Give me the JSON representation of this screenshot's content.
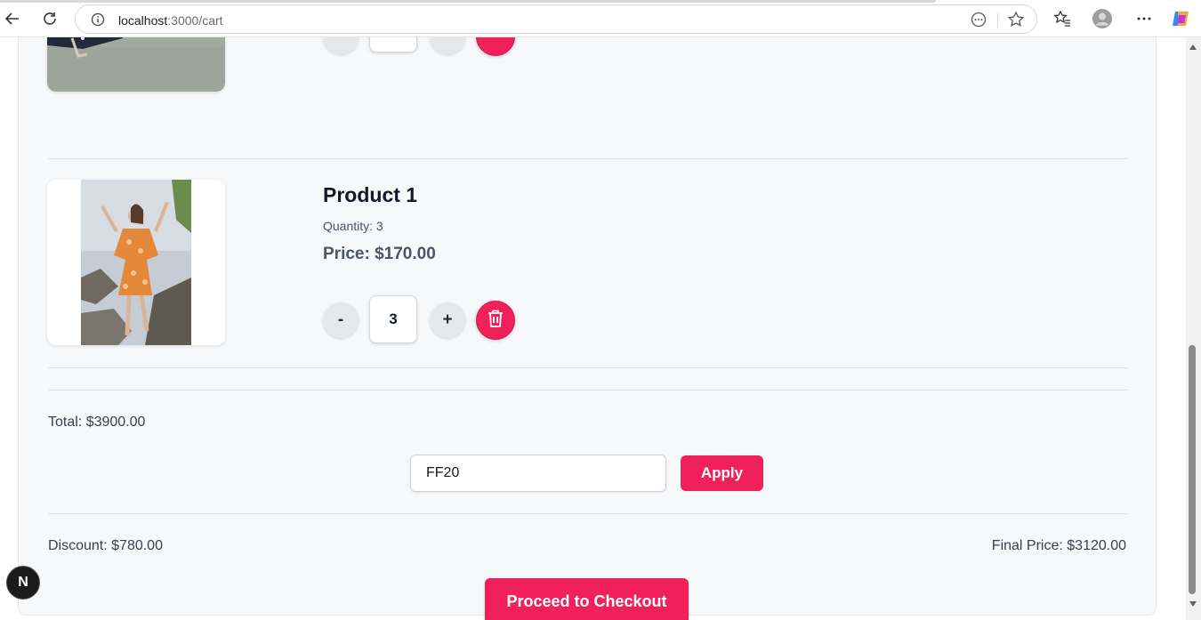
{
  "browser": {
    "url_host": "localhost",
    "url_path": ":3000/cart",
    "icons": [
      "back-icon",
      "reload-icon",
      "site-info-icon",
      "reader-mode-icon",
      "favorite-star-icon",
      "favorites-icon",
      "profile-icon",
      "more-menu-icon",
      "copilot-icon"
    ]
  },
  "cart": {
    "items": [
      {
        "name": "Product 1",
        "quantity_label": "Quantity: 3",
        "price_label": "Price: $170.00",
        "quantity_value": "3",
        "decrement_label": "-",
        "increment_label": "+"
      }
    ],
    "total_label": "Total: $3900.00",
    "coupon": {
      "value": "FF20",
      "apply_label": "Apply"
    },
    "discount_label": "Discount: $780.00",
    "final_price_label": "Final Price: $3120.00",
    "checkout_label": "Proceed to Checkout"
  },
  "dev_badge": {
    "label": "N"
  },
  "colors": {
    "accent": "#f0205a",
    "page_bg": "#f7f8fa",
    "text": "#111827"
  }
}
